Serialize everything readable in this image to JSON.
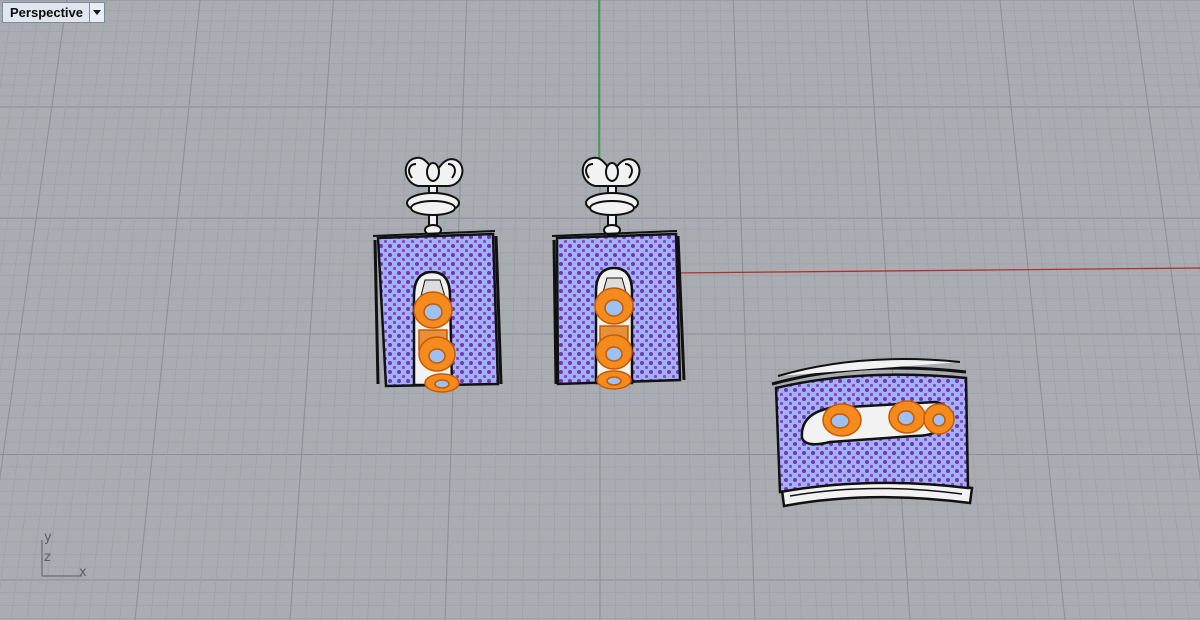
{
  "viewport": {
    "title": "Perspective",
    "dropdown_icon": "caret-down-icon"
  },
  "axes": {
    "x_label": "x",
    "y_label": "y",
    "z_label": "z",
    "x_color": "#b03030",
    "y_color": "#1f9c33"
  },
  "colors": {
    "background": "#a9acb1",
    "grid_minor": "#9ea2a8",
    "grid_major": "#8d9197",
    "metal_fill": "#f2f2f2",
    "metal_outline": "#111111",
    "pave_fill": "#a0b4f5",
    "pave_dot": "#7a32b8",
    "accent_stone": "#f58a1f",
    "accent_stone_center": "#9ec0f2"
  },
  "scene": {
    "objects": [
      {
        "name": "left-earring",
        "accent_stones": 3
      },
      {
        "name": "right-earring",
        "accent_stones": 3
      },
      {
        "name": "ring",
        "accent_stones": 3
      }
    ]
  }
}
